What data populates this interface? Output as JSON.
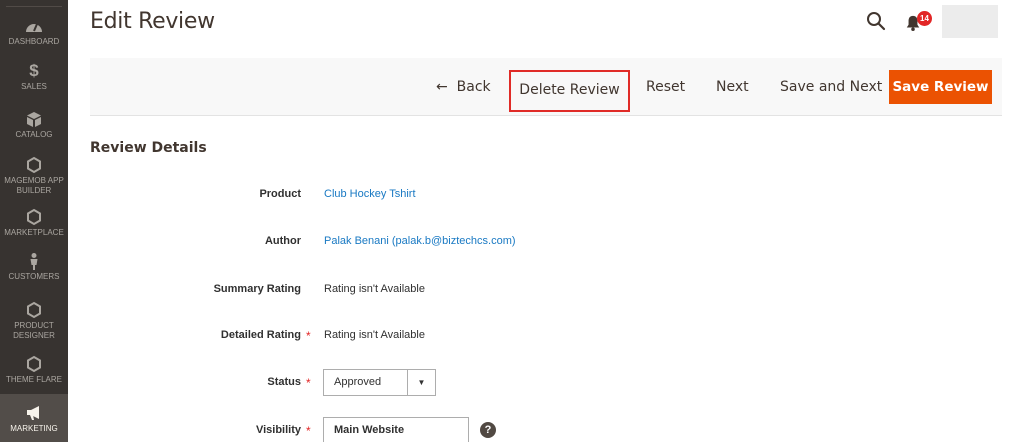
{
  "sidebar": {
    "items": [
      {
        "label": "DASHBOARD",
        "icon": "dashboard-icon"
      },
      {
        "label": "SALES",
        "icon": "dollar-icon"
      },
      {
        "label": "CATALOG",
        "icon": "cube-icon"
      },
      {
        "label": "MAGEMOB APP BUILDER",
        "icon": "hexagon-icon"
      },
      {
        "label": "MARKETPLACE",
        "icon": "hexagon-icon"
      },
      {
        "label": "CUSTOMERS",
        "icon": "person-icon"
      },
      {
        "label": "PRODUCT DESIGNER",
        "icon": "hexagon-icon"
      },
      {
        "label": "THEME FLARE",
        "icon": "hexagon-icon"
      },
      {
        "label": "MARKETING",
        "icon": "megaphone-icon"
      }
    ]
  },
  "header": {
    "title": "Edit Review",
    "notifications_count": "14"
  },
  "actions": {
    "back": "Back",
    "delete": "Delete Review",
    "reset": "Reset",
    "next": "Next",
    "save_next": "Save and Next",
    "save": "Save Review"
  },
  "form": {
    "section_title": "Review Details",
    "product_label": "Product",
    "product_value": "Club Hockey Tshirt",
    "author_label": "Author",
    "author_value": "Palak Benani (palak.b@biztechcs.com)",
    "summary_label": "Summary Rating",
    "summary_value": "Rating isn't Available",
    "detailed_label": "Detailed Rating",
    "detailed_value": "Rating isn't Available",
    "status_label": "Status",
    "status_value": "Approved",
    "visibility_label": "Visibility",
    "visibility_value": "Main Website",
    "required_mark": "*",
    "help_mark": "?"
  },
  "colors": {
    "sidebar_bg": "#373330",
    "primary_button": "#eb5202",
    "link": "#1979c3",
    "highlight_border": "#e02b27",
    "badge": "#e22626"
  }
}
